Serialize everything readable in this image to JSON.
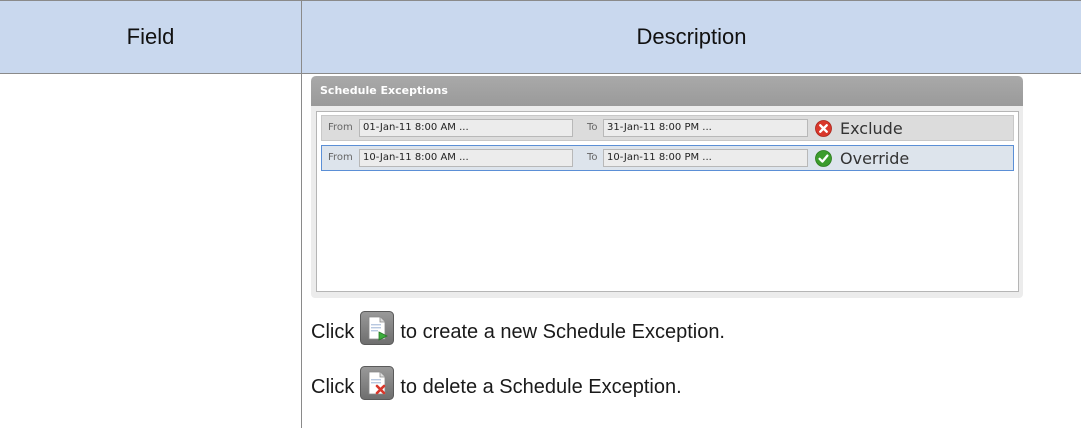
{
  "header": {
    "field_label": "Field",
    "description_label": "Description"
  },
  "panel": {
    "title": "Schedule Exceptions",
    "rows": [
      {
        "from_label": "From",
        "from_value": "01-Jan-11 8:00 AM ...",
        "to_label": "To",
        "to_value": "31-Jan-11 8:00 PM ...",
        "status": "Exclude",
        "status_icon": "exclude-icon",
        "status_color": "#d9372b",
        "selected": false
      },
      {
        "from_label": "From",
        "from_value": "10-Jan-11 8:00 AM ...",
        "to_label": "To",
        "to_value": "10-Jan-11 8:00 PM ...",
        "status": "Override",
        "status_icon": "override-icon",
        "status_color": "#3c9c2c",
        "selected": true
      }
    ]
  },
  "instructions": {
    "click_word": "Click",
    "create_text": "to create a new Schedule Exception.",
    "delete_text": "to delete a Schedule Exception.",
    "create_icon": "new-document-icon",
    "delete_icon": "delete-document-icon"
  },
  "colors": {
    "header_bg": "#c9d8ee",
    "panel_title_bg": "#9a9a9a",
    "selected_row_border": "#5b8fd6"
  }
}
